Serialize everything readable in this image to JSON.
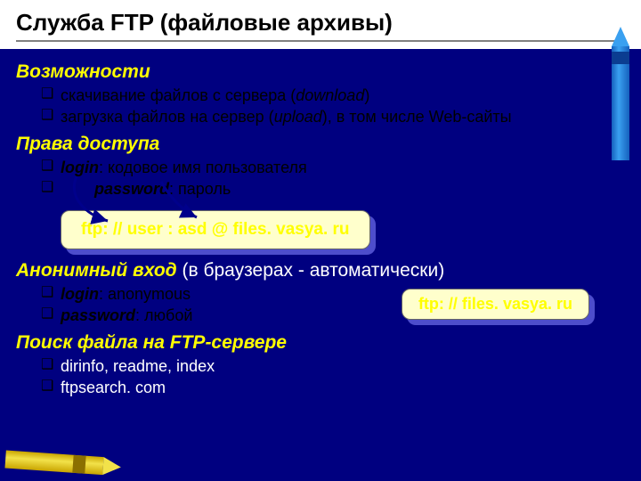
{
  "title": "Служба FTP (файловые архивы)",
  "sections": {
    "capab": {
      "heading": "Возможности",
      "items": [
        {
          "pre": "скачивание файлов c сервера (",
          "em": "download",
          "post": ")"
        },
        {
          "pre": "загрузка файлов на сервер (",
          "em": "upload",
          "post": "), в том числе Web-сайты"
        }
      ]
    },
    "access": {
      "heading": "Права доступа",
      "items": [
        {
          "b": "login",
          "rest": ": кодовое имя пользователя"
        },
        {
          "b": "password",
          "rest": ": пароль",
          "indent": true
        }
      ],
      "box": "ftp: // user : asd @ files. vasya. ru"
    },
    "anon": {
      "heading": "Анонимный вход",
      "heading_rest": " (в браузерах - автоматически)",
      "items": [
        {
          "b": "login",
          "rest": ": anonymous"
        },
        {
          "b": "password",
          "rest": ": любой"
        }
      ],
      "box": "ftp: // files. vasya. ru"
    },
    "search": {
      "heading": "Поиск файла на FTP-сервере",
      "items": [
        {
          "text": "dirinfo, readme, index"
        },
        {
          "text": "ftpsearch. com"
        }
      ]
    }
  }
}
